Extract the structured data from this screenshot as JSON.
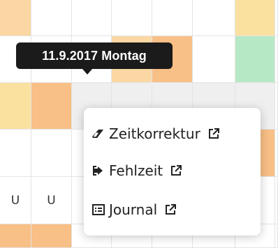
{
  "colors": {
    "grid_line": "#e4e4e4",
    "light_orange": "#fbd7a4",
    "orange": "#f8bf86",
    "light_yellow": "#fbe1a0",
    "green": "#b7e8c6",
    "selected_gray": "#efefef",
    "tooltip_bg": "#1b1b1b",
    "menu_bg": "#ffffff"
  },
  "grid": {
    "columns": 8,
    "rows": [
      [
        "light_orange",
        "",
        "",
        "",
        "",
        "",
        "light_yellow",
        ""
      ],
      [
        "",
        "",
        "",
        "light_orange",
        "orange",
        "",
        "green",
        ""
      ],
      [
        "light_yellow",
        "orange",
        "selected_gray",
        "selected_gray",
        "selected_gray",
        "selected_gray",
        "selected_gray",
        ""
      ],
      [
        "",
        "",
        "",
        "",
        "",
        "",
        "orange",
        ""
      ],
      [
        "U",
        "U",
        "",
        "",
        "",
        "",
        "",
        ""
      ],
      [
        "orange",
        "orange",
        "",
        "",
        "",
        "",
        "",
        ""
      ]
    ],
    "u_label": "U"
  },
  "tooltip": {
    "text": "11.9.2017 Montag"
  },
  "menu": {
    "items": [
      {
        "label": "Zeitkorrektur",
        "icon": "eraser-icon",
        "external_icon": "external-link-icon"
      },
      {
        "label": "Fehlzeit",
        "icon": "sign-out-icon",
        "external_icon": "external-link-icon"
      },
      {
        "label": "Journal",
        "icon": "list-alt-icon",
        "external_icon": "external-link-icon"
      }
    ]
  }
}
